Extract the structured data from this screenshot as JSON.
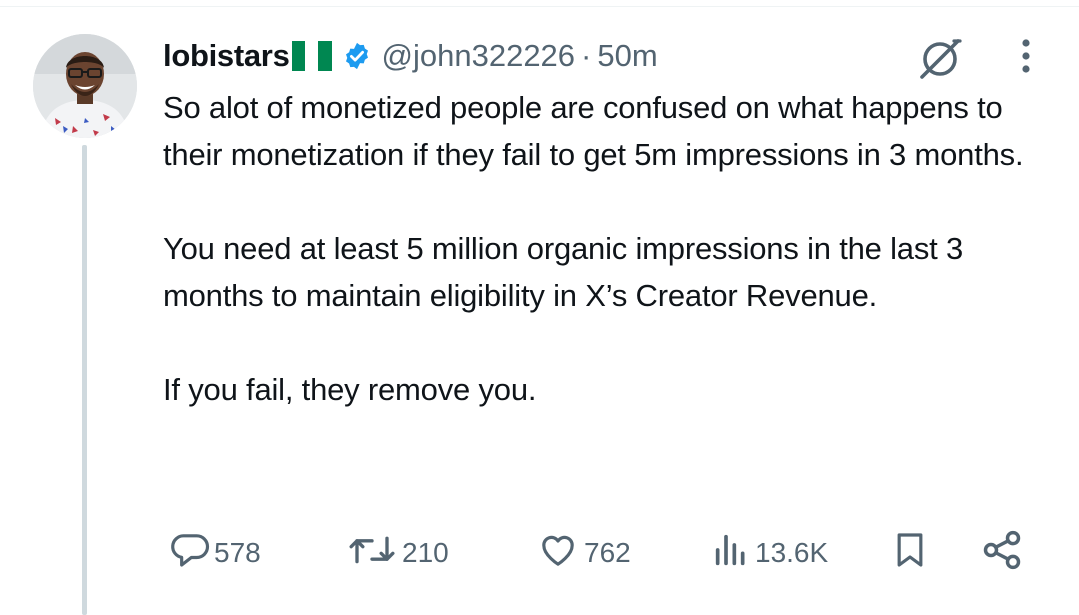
{
  "tweet": {
    "author": {
      "display_name": "lobistars",
      "handle": "@john322226",
      "verified": true,
      "flag": "Nigeria"
    },
    "separator": "·",
    "time": "50m",
    "paragraphs": [
      "So alot of monetized people are confused on what happens to their monetization if they fail to get 5m impressions in 3 months.",
      "You need at least 5 million organic impressions in the last 3 months to maintain eligibility in X’s Creator Revenue.",
      "If you fail, they remove you."
    ],
    "actions": {
      "replies": "578",
      "reposts": "210",
      "likes": "762",
      "views": "13.6K"
    }
  },
  "icons": {
    "header": [
      "verified-badge-icon",
      "grok-icon",
      "more-icon"
    ],
    "actions": [
      "reply-icon",
      "repost-icon",
      "like-icon",
      "views-icon",
      "bookmark-icon",
      "share-icon"
    ]
  },
  "colors": {
    "text": "#0f1419",
    "muted": "#536471",
    "verified": "#1d9bf0",
    "flag_green": "#008751",
    "thread_line": "#cfd9de"
  }
}
